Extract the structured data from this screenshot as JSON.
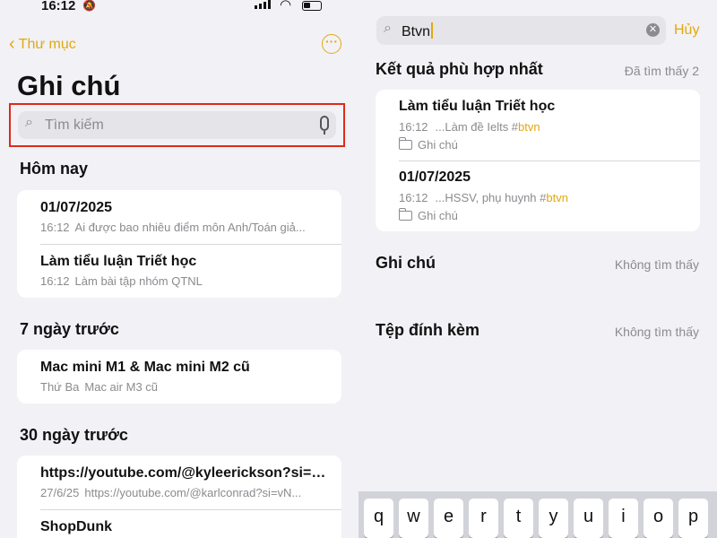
{
  "left": {
    "status": {
      "time": "16:12"
    },
    "nav": {
      "back_label": "Thư mục",
      "more_symbol": "···"
    },
    "title": "Ghi chú",
    "search": {
      "placeholder": "Tìm kiếm"
    },
    "sections": [
      {
        "title": "Hôm nay",
        "notes": [
          {
            "title": "01/07/2025",
            "date": "16:12",
            "preview": "Ai được bao nhiêu điểm môn Anh/Toán giả..."
          },
          {
            "title": "Làm tiểu luận Triết học",
            "date": "16:12",
            "preview": "Làm bài tập nhóm QTNL"
          }
        ]
      },
      {
        "title": "7 ngày trước",
        "notes": [
          {
            "title": "Mac mini M1 & Mac mini M2 cũ",
            "date": "Thứ Ba",
            "preview": "Mac air M3 cũ"
          }
        ]
      },
      {
        "title": "30 ngày trước",
        "notes": [
          {
            "title": "https://youtube.com/@kyleerickson?si=R...",
            "date": "27/6/25",
            "preview": "https://youtube.com/@karlconrad?si=vN..."
          },
          {
            "title": "ShopDunk",
            "date": "",
            "preview": ""
          }
        ]
      }
    ]
  },
  "right": {
    "search": {
      "query": "Btvn"
    },
    "cancel_label": "Hủy",
    "best_match": {
      "title": "Kết quả phù hợp nhất",
      "count_label": "Đã tìm thấy 2",
      "results": [
        {
          "title": "Làm tiểu luận Triết học",
          "date": "16:12",
          "preview": "...Làm đề Ielts #",
          "tag": "btvn",
          "folder": "Ghi chú"
        },
        {
          "title": "01/07/2025",
          "date": "16:12",
          "preview": "...HSSV, phụ huynh #",
          "tag": "btvn",
          "folder": "Ghi chú"
        }
      ]
    },
    "notes_section": {
      "title": "Ghi chú",
      "status": "Không tìm thấy"
    },
    "attachments_section": {
      "title": "Tệp đính kèm",
      "status": "Không tìm thấy"
    },
    "keyboard": {
      "keys": [
        "q",
        "w",
        "e",
        "r",
        "t",
        "y",
        "u",
        "i",
        "o",
        "p"
      ]
    }
  },
  "colors": {
    "accent": "#e3a80e",
    "highlight_border": "#e0281e",
    "background": "#f2f2f6"
  }
}
